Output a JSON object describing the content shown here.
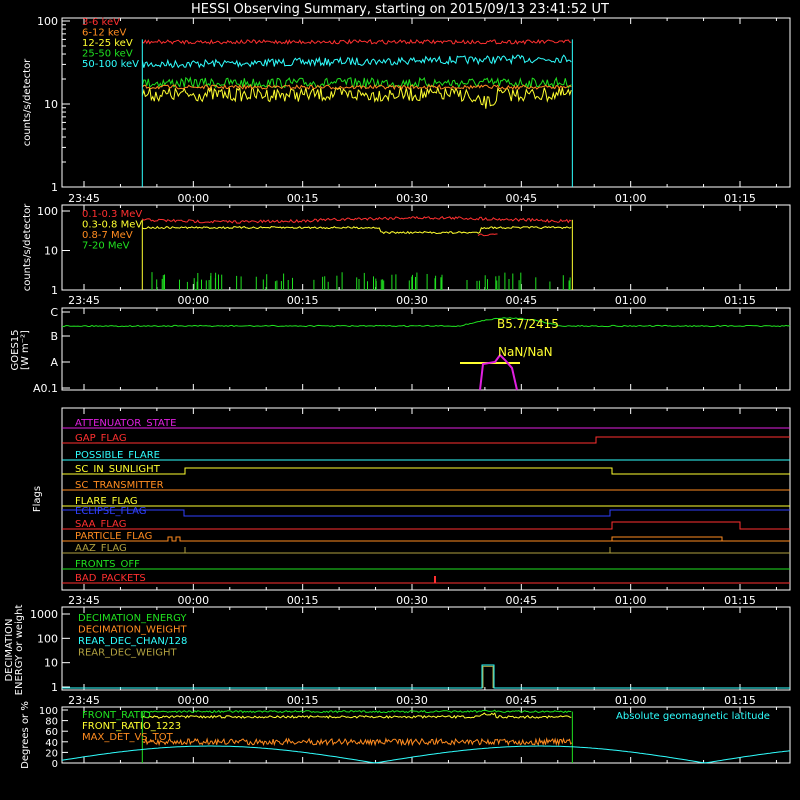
{
  "title": "HESSI Observing Summary, starting on 2015/09/13 23:41:52 UT",
  "time_ticks": [
    "23:45",
    "00:00",
    "00:15",
    "00:30",
    "00:45",
    "01:00",
    "01:15"
  ],
  "colors": {
    "red": "#ff3030",
    "orange": "#ff8c20",
    "yellow": "#ffff30",
    "green": "#20e020",
    "cyan": "#30ffff",
    "magenta": "#e020e0",
    "blue": "#3040ff",
    "olive": "#b0a040",
    "white": "#ffffff"
  },
  "chart_data": [
    {
      "id": "lightcurves_lo",
      "type": "line",
      "ylabel": "counts/s/detector",
      "yscale": "log",
      "yticks": [
        "1",
        "10",
        "100"
      ],
      "legend_position": "top-left",
      "series": [
        {
          "name": "3-6 keV",
          "color": "red",
          "level": 56
        },
        {
          "name": "6-12 keV",
          "color": "orange",
          "level": 16
        },
        {
          "name": "12-25 keV",
          "color": "yellow",
          "level": 13
        },
        {
          "name": "25-50 keV",
          "color": "green",
          "level": 18
        },
        {
          "name": "50-100 keV",
          "color": "cyan",
          "level": 30
        }
      ],
      "data_start": "23:53",
      "data_end": "00:52"
    },
    {
      "id": "lightcurves_hi",
      "type": "line",
      "ylabel": "counts/s/detector",
      "yscale": "log",
      "yticks": [
        "1",
        "10",
        "100"
      ],
      "legend_position": "top-left",
      "series": [
        {
          "name": "0.1-0.3 MeV",
          "color": "red",
          "level": 60
        },
        {
          "name": "0.3-0.8 MeV",
          "color": "yellow",
          "level": 38
        },
        {
          "name": "0.8-7 MeV",
          "color": "orange",
          "level": null
        },
        {
          "name": "7-20 MeV",
          "color": "green",
          "level": 1.5
        }
      ],
      "data_start": "23:53",
      "data_end": "00:52"
    },
    {
      "id": "goes",
      "type": "line",
      "ylabel": "GOES15 [W m⁻²]",
      "yticks": [
        "A0.1",
        "A",
        "B",
        "C"
      ],
      "annotations": [
        "B5.7/2415",
        "NaN/NaN"
      ]
    },
    {
      "id": "flags",
      "type": "line",
      "ylabel": "Flags",
      "flags": [
        {
          "name": "ATTENUATOR_STATE",
          "color": "magenta"
        },
        {
          "name": "SAA_FLAG",
          "color": "red"
        },
        {
          "name": "PARTICLE_FLAG",
          "color": "orange"
        },
        {
          "name": "GAP_FLAG",
          "color": "red"
        },
        {
          "name": "POSSIBLE_FLARE",
          "color": "cyan"
        },
        {
          "name": "SC_IN_SUNLIGHT",
          "color": "yellow"
        },
        {
          "name": "SC_TRANSMITTER",
          "color": "orange"
        },
        {
          "name": "FLARE_FLAG",
          "color": "yellow"
        },
        {
          "name": "ECLIPSE_FLAG",
          "color": "blue"
        },
        {
          "name": "AAZ_FLAG",
          "color": "olive"
        },
        {
          "name": "FRONTS_OFF",
          "color": "green"
        },
        {
          "name": "BAD_PACKETS",
          "color": "red"
        }
      ]
    },
    {
      "id": "decimation",
      "type": "line",
      "ylabel": "DECIMATION ENERGY or weight",
      "yscale": "log",
      "yticks": [
        "1",
        "10",
        "100",
        "1000"
      ],
      "series": [
        {
          "name": "DECIMATION_ENERGY",
          "color": "green"
        },
        {
          "name": "DECIMATION_WEIGHT",
          "color": "orange"
        },
        {
          "name": "REAR_DEC_CHAN/128",
          "color": "cyan",
          "value": 8
        },
        {
          "name": "REAR_DEC_WEIGHT",
          "color": "olive"
        }
      ]
    },
    {
      "id": "ratios",
      "type": "line",
      "ylabel": "Degrees or %",
      "yticks": [
        "0",
        "20",
        "40",
        "60",
        "80",
        "100"
      ],
      "ylim": [
        0,
        100
      ],
      "series": [
        {
          "name": "FRONT_RATIO",
          "color": "green",
          "level": 97
        },
        {
          "name": "FRONT_RATIO_1223",
          "color": "yellow",
          "level": 88
        },
        {
          "name": "MAX_DET_VS_TOT",
          "color": "orange",
          "level": 40
        },
        {
          "name": "Absolute geomagnetic latitude",
          "color": "cyan"
        }
      ]
    }
  ]
}
